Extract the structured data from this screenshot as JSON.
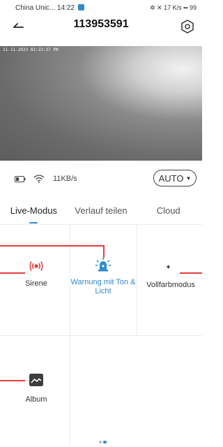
{
  "status_bar": {
    "carrier_time": "China Unic... 14:22",
    "right_info": "17 K/s ▪▪ 99"
  },
  "header": {
    "title": "113953591"
  },
  "video": {
    "timestamp": "11-11-2023 02:22:37 PM"
  },
  "info_row": {
    "speed": "11KB/s",
    "mode": "AUTO"
  },
  "tabs": [
    {
      "label": "Live-Modus"
    },
    {
      "label": "Verlauf teilen"
    },
    {
      "label": "Cloud"
    }
  ],
  "features": {
    "siren": {
      "label": "Sirene",
      "icon": "siren-icon"
    },
    "warning": {
      "label": "Warnung mit Ton & Licht",
      "icon": "alarm-light-icon"
    },
    "fullcolor": {
      "label": "Vollfarbmodus",
      "icon": "moon-star-icon"
    },
    "album": {
      "label": "Album",
      "icon": "image-icon"
    }
  },
  "colors": {
    "accent": "#2e8bcf",
    "siren": "#e0403b",
    "annotation": "#e0403b"
  }
}
